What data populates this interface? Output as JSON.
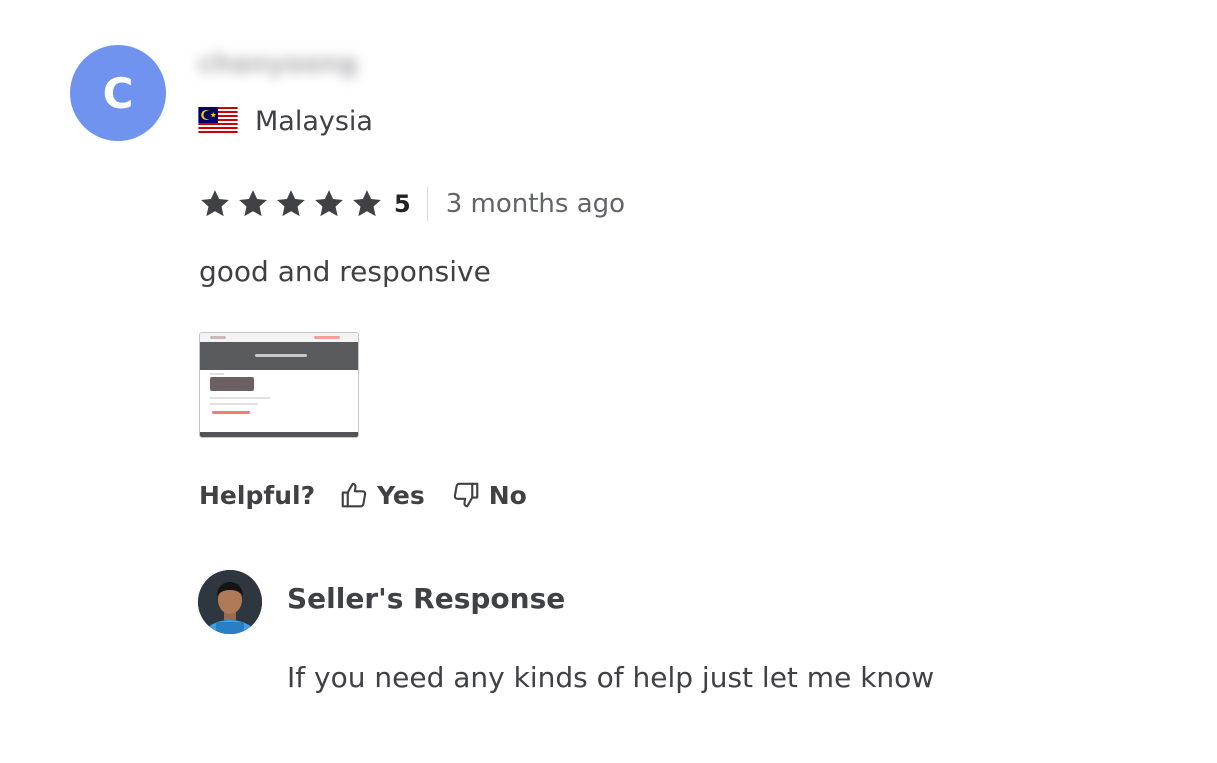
{
  "review": {
    "avatar_initial": "C",
    "avatar_color": "#6f93ef",
    "username": "chanyoong",
    "country": "Malaysia",
    "country_flag_icon": "malaysia-flag-icon",
    "rating": "5",
    "stars_filled": 5,
    "stars_total": 5,
    "time_ago": "3 months ago",
    "text": "good and responsive",
    "attachment_icon": "screenshot-thumbnail"
  },
  "helpful": {
    "label": "Helpful?",
    "yes_label": "Yes",
    "yes_icon": "thumbs-up-icon",
    "no_label": "No",
    "no_icon": "thumbs-down-icon"
  },
  "seller_response": {
    "title": "Seller's Response",
    "text": "If you need any kinds of help just let me know",
    "avatar_icon": "seller-avatar-photo"
  },
  "colors": {
    "star": "#404145",
    "text_dark": "#404145",
    "text_muted": "#62646a",
    "flag_red": "#cc0001",
    "flag_blue": "#010066",
    "flag_yellow": "#ffcc00"
  }
}
